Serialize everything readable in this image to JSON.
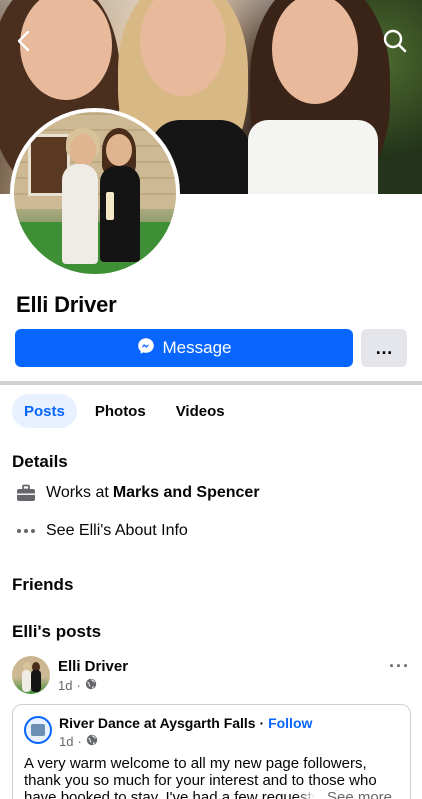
{
  "profile": {
    "name": "Elli Driver"
  },
  "actions": {
    "message_label": "Message",
    "more_label": "…"
  },
  "tabs": [
    {
      "label": "Posts",
      "active": true
    },
    {
      "label": "Photos",
      "active": false
    },
    {
      "label": "Videos",
      "active": false
    }
  ],
  "details": {
    "title": "Details",
    "work_prefix": "Works at",
    "work_place": "Marks and Spencer",
    "about_link": "See Elli's About Info"
  },
  "friends": {
    "title": "Friends"
  },
  "posts": {
    "title": "Elli's posts",
    "items": [
      {
        "author": "Elli Driver",
        "time": "1d",
        "shared": {
          "page_name": "River Dance at Aysgarth Falls",
          "separator": " · ",
          "follow_label": "Follow",
          "time": "1d",
          "text": "A very warm welcome to all my new page followers, thank you so much for your interest and to those who have booked to stay. I've had a few requests",
          "see_more": "... See more"
        }
      }
    ]
  },
  "colors": {
    "accent": "#0866ff",
    "tab_active_bg": "#e7f1ff",
    "muted": "#65676b",
    "divider": "#ced0d4",
    "secondary_button": "#e4e6eb"
  },
  "icons": {
    "back": "chevron-left-icon",
    "search": "search-icon",
    "messenger": "messenger-icon",
    "work": "briefcase-icon",
    "about": "more-horizontal-icon",
    "privacy": "globe-icon"
  }
}
